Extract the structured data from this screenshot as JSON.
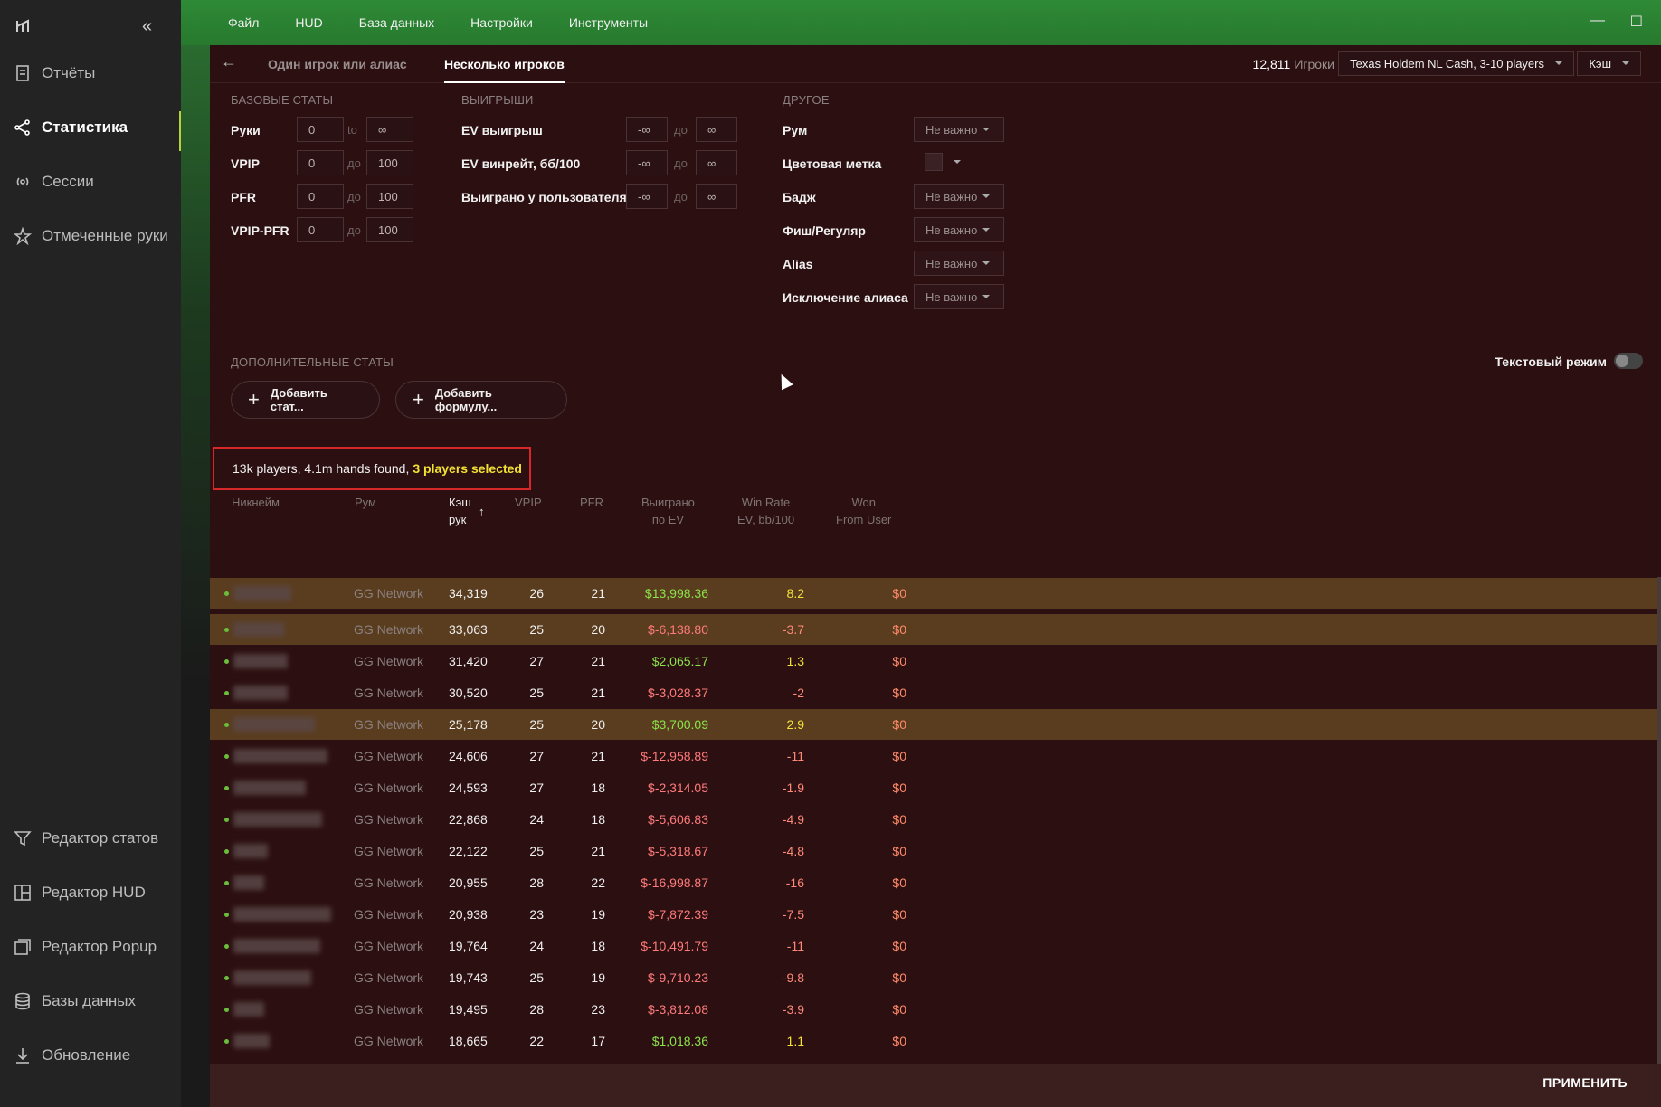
{
  "sidebar": {
    "items": [
      {
        "label": "Отчёты",
        "icon": "report-icon"
      },
      {
        "label": "Статистика",
        "icon": "stats-icon"
      },
      {
        "label": "Сессии",
        "icon": "sessions-icon"
      },
      {
        "label": "Отмеченные руки",
        "icon": "marked-hands-icon"
      }
    ],
    "bottom_items": [
      {
        "label": "Редактор статов",
        "icon": "filter-icon"
      },
      {
        "label": "Редактор HUD",
        "icon": "hud-editor-icon"
      },
      {
        "label": "Редактор Popup",
        "icon": "popup-editor-icon"
      },
      {
        "label": "Базы данных",
        "icon": "database-icon"
      },
      {
        "label": "Обновление",
        "icon": "download-icon"
      }
    ]
  },
  "menu": [
    "Файл",
    "HUD",
    "База данных",
    "Настройки",
    "Инструменты"
  ],
  "tabs": {
    "single": "Один игрок или алиас",
    "multi": "Несколько игроков"
  },
  "header": {
    "player_count": "12,811",
    "player_count_label": "Игроки",
    "game_select": "Texas Holdem NL Cash, 3-10 players",
    "mode_select": "Кэш"
  },
  "filters": {
    "base": {
      "title": "БАЗОВЫЕ СТАТЫ",
      "rows": [
        {
          "label": "Руки",
          "from": "0",
          "sep": "to",
          "to": "∞"
        },
        {
          "label": "VPIP",
          "from": "0",
          "sep": "до",
          "to": "100"
        },
        {
          "label": "PFR",
          "from": "0",
          "sep": "до",
          "to": "100"
        },
        {
          "label": "VPIP-PFR",
          "from": "0",
          "sep": "до",
          "to": "100"
        }
      ]
    },
    "winnings": {
      "title": "ВЫИГРЫШИ",
      "rows": [
        {
          "label": "EV выигрыш",
          "from": "-∞",
          "sep": "до",
          "to": "∞"
        },
        {
          "label": "EV винрейт, бб/100",
          "from": "-∞",
          "sep": "до",
          "to": "∞"
        },
        {
          "label": "Выиграно у пользователя",
          "from": "-∞",
          "sep": "до",
          "to": "∞"
        }
      ]
    },
    "other": {
      "title": "ДРУГОЕ",
      "rows": [
        {
          "label": "Рум",
          "value": "Не важно"
        },
        {
          "label": "Цветовая метка",
          "value": ""
        },
        {
          "label": "Бадж",
          "value": "Не важно"
        },
        {
          "label": "Фиш/Регуляр",
          "value": "Не важно"
        },
        {
          "label": "Alias",
          "value": "Не важно"
        },
        {
          "label": "Исключение алиаса",
          "value": "Не важно"
        }
      ]
    }
  },
  "extra": {
    "title": "ДОПОЛНИТЕЛЬНЫЕ СТАТЫ",
    "add_stat": "Добавить стат...",
    "add_formula": "Добавить формулу...",
    "text_mode": "Текстовый режим"
  },
  "found": {
    "text": "13k players, 4.1m hands found,",
    "selected": "3 players selected"
  },
  "table": {
    "headers": {
      "nickname": "Никнейм",
      "room": "Рум",
      "hands_1": "Кэш",
      "hands_2": "рук",
      "sort_arrow": "↑",
      "vpip": "VPIP",
      "pfr": "PFR",
      "won_ev_1": "Выиграно",
      "won_ev_2": "по EV",
      "wr_1": "Win Rate",
      "wr_2": "EV, bb/100",
      "wfu_1": "Won",
      "wfu_2": "From User"
    },
    "rows": [
      {
        "room": "GG Network",
        "hands": "34,319",
        "vpip": "26",
        "pfr": "21",
        "won": "$13,998.36",
        "wr": "8.2",
        "wfu": "$0",
        "selected": true
      },
      {
        "room": "GG Network",
        "hands": "33,063",
        "vpip": "25",
        "pfr": "20",
        "won": "$-6,138.80",
        "wr": "-3.7",
        "wfu": "$0",
        "selected": true
      },
      {
        "room": "GG Network",
        "hands": "31,420",
        "vpip": "27",
        "pfr": "21",
        "won": "$2,065.17",
        "wr": "1.3",
        "wfu": "$0",
        "selected": false
      },
      {
        "room": "GG Network",
        "hands": "30,520",
        "vpip": "25",
        "pfr": "21",
        "won": "$-3,028.37",
        "wr": "-2",
        "wfu": "$0",
        "selected": false
      },
      {
        "room": "GG Network",
        "hands": "25,178",
        "vpip": "25",
        "pfr": "20",
        "won": "$3,700.09",
        "wr": "2.9",
        "wfu": "$0",
        "selected": true
      },
      {
        "room": "GG Network",
        "hands": "24,606",
        "vpip": "27",
        "pfr": "21",
        "won": "$-12,958.89",
        "wr": "-11",
        "wfu": "$0",
        "selected": false
      },
      {
        "room": "GG Network",
        "hands": "24,593",
        "vpip": "27",
        "pfr": "18",
        "won": "$-2,314.05",
        "wr": "-1.9",
        "wfu": "$0",
        "selected": false
      },
      {
        "room": "GG Network",
        "hands": "22,868",
        "vpip": "24",
        "pfr": "18",
        "won": "$-5,606.83",
        "wr": "-4.9",
        "wfu": "$0",
        "selected": false
      },
      {
        "room": "GG Network",
        "hands": "22,122",
        "vpip": "25",
        "pfr": "21",
        "won": "$-5,318.67",
        "wr": "-4.8",
        "wfu": "$0",
        "selected": false
      },
      {
        "room": "GG Network",
        "hands": "20,955",
        "vpip": "28",
        "pfr": "22",
        "won": "$-16,998.87",
        "wr": "-16",
        "wfu": "$0",
        "selected": false
      },
      {
        "room": "GG Network",
        "hands": "20,938",
        "vpip": "23",
        "pfr": "19",
        "won": "$-7,872.39",
        "wr": "-7.5",
        "wfu": "$0",
        "selected": false
      },
      {
        "room": "GG Network",
        "hands": "19,764",
        "vpip": "24",
        "pfr": "18",
        "won": "$-10,491.79",
        "wr": "-11",
        "wfu": "$0",
        "selected": false
      },
      {
        "room": "GG Network",
        "hands": "19,743",
        "vpip": "25",
        "pfr": "19",
        "won": "$-9,710.23",
        "wr": "-9.8",
        "wfu": "$0",
        "selected": false
      },
      {
        "room": "GG Network",
        "hands": "19,495",
        "vpip": "28",
        "pfr": "23",
        "won": "$-3,812.08",
        "wr": "-3.9",
        "wfu": "$0",
        "selected": false
      },
      {
        "room": "GG Network",
        "hands": "18,665",
        "vpip": "22",
        "pfr": "17",
        "won": "$1,018.36",
        "wr": "1.1",
        "wfu": "$0",
        "selected": false
      }
    ]
  },
  "footer": {
    "apply": "ПРИМЕНИТЬ"
  },
  "colors": {
    "topbar": "#2e8a36",
    "accent": "#b8d23a",
    "selected_row": "#5a3d1f",
    "positive": "#8be34a",
    "negative": "#ff7a7a",
    "highlight": "#f2e233",
    "border_red": "#d62828"
  }
}
